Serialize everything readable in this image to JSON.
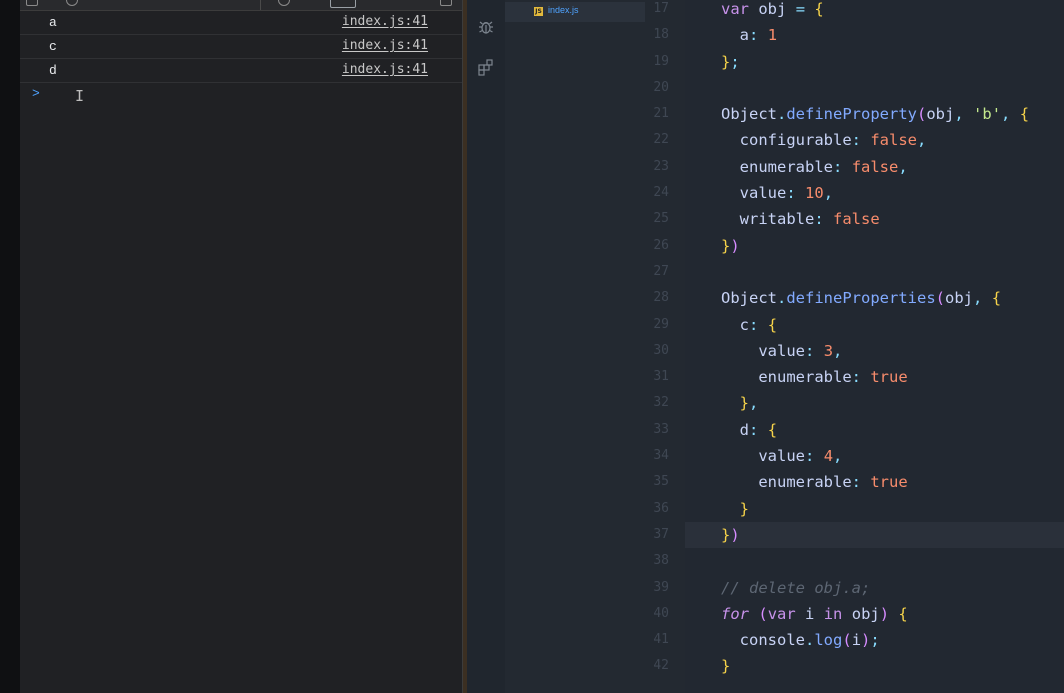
{
  "console": {
    "logs": [
      {
        "message": "a",
        "source": "index.js:41"
      },
      {
        "message": "c",
        "source": "index.js:41"
      },
      {
        "message": "d",
        "source": "index.js:41"
      }
    ],
    "prompt_symbol": ">",
    "text_cursor": "I"
  },
  "explorer": {
    "active_file": "index.js",
    "file_icon_text": "JS"
  },
  "editor": {
    "line_numbers": [
      "17",
      "18",
      "19",
      "20",
      "21",
      "22",
      "23",
      "24",
      "25",
      "26",
      "27",
      "28",
      "29",
      "30",
      "31",
      "32",
      "33",
      "34",
      "35",
      "36",
      "37",
      "38",
      "39",
      "40",
      "41",
      "42"
    ],
    "code_lines": [
      "var obj = {",
      "  a: 1",
      "};",
      "",
      "Object.defineProperty(obj, 'b', {",
      "  configurable: false,",
      "  enumerable: false,",
      "  value: 10,",
      "  writable: false",
      "})",
      "",
      "Object.defineProperties(obj, {",
      "  c: {",
      "    value: 3,",
      "    enumerable: true",
      "  },",
      "  d: {",
      "    value: 4,",
      "    enumerable: true",
      "  }",
      "})",
      "",
      "// delete obj.a;",
      "for (var i in obj) {",
      "  console.log(i);",
      "}"
    ]
  },
  "colors": {
    "keyword": "#c792ea",
    "string": "#c3e88d",
    "number": "#f78c6c",
    "function": "#82aaff",
    "console_link": "#c8c8c8",
    "prompt": "#4fa3ff"
  },
  "icons": [
    "debug-icon",
    "extensions-icon",
    "js-file-icon"
  ]
}
